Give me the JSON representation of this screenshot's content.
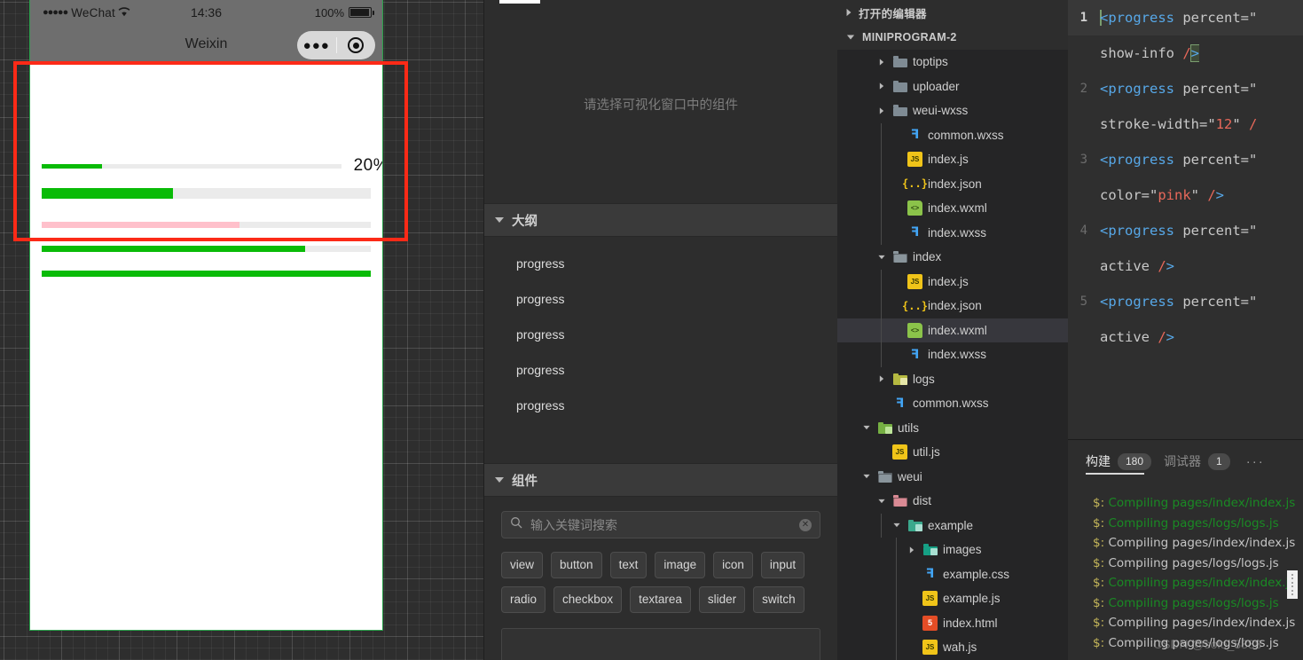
{
  "simulator": {
    "status_bar": {
      "carrier_dots": "●●●●●",
      "carrier": "WeChat",
      "wifi_icon": "wifi-icon",
      "time": "14:36",
      "battery_percent": "100%",
      "battery_icon": "battery-full-icon"
    },
    "nav_bar": {
      "title": "Weixin",
      "capsule_more_icon": "more-dots-icon",
      "capsule_target_icon": "target-circle-icon"
    },
    "progress_bars": [
      {
        "percent": 20,
        "color": "#09BB07",
        "track": "#EBEBEB",
        "height": 5,
        "width_pct": 91,
        "show_info": true,
        "info_label": "20%"
      },
      {
        "percent": 40,
        "color": "#09BB07",
        "track": "#EBEBEB",
        "height": 12,
        "width_pct": 100,
        "show_info": false,
        "info_label": ""
      },
      {
        "percent": 60,
        "color": "#FFC0CB",
        "track": "#EBEBEB",
        "height": 7,
        "width_pct": 100,
        "show_info": false,
        "info_label": ""
      },
      {
        "percent": 80,
        "color": "#09BB07",
        "track": "#EBEBEB",
        "height": 7,
        "width_pct": 100,
        "show_info": false,
        "info_label": ""
      },
      {
        "percent": 100,
        "color": "#09BB07",
        "track": "#EBEBEB",
        "height": 7,
        "width_pct": 100,
        "show_info": false,
        "info_label": ""
      }
    ],
    "highlight_color": "#FC2A17"
  },
  "middle_panel": {
    "wxml_placeholder": "请选择可视化窗口中的组件",
    "outline": {
      "title": "大纲",
      "items": [
        {
          "label": "progress"
        },
        {
          "label": "progress"
        },
        {
          "label": "progress"
        },
        {
          "label": "progress"
        },
        {
          "label": "progress"
        }
      ]
    },
    "components": {
      "title": "组件",
      "search_placeholder": "输入关键词搜索",
      "search_value": "",
      "search_icon": "search-icon",
      "clear_icon": "clear-circle-icon",
      "tags": [
        "view",
        "button",
        "text",
        "image",
        "icon",
        "input",
        "radio",
        "checkbox",
        "textarea",
        "slider",
        "switch"
      ]
    }
  },
  "file_tree": {
    "open_editors_label": "打开的编辑器",
    "project_label": "MINIPROGRAM-2",
    "nodes": [
      {
        "label": "toptips",
        "type": "folder",
        "depth": 2,
        "expanded": false,
        "selected": false
      },
      {
        "label": "uploader",
        "type": "folder",
        "depth": 2,
        "expanded": false,
        "selected": false
      },
      {
        "label": "weui-wxss",
        "type": "folder",
        "depth": 2,
        "expanded": false,
        "selected": false
      },
      {
        "label": "common.wxss",
        "type": "css",
        "depth": 3,
        "expanded": null,
        "selected": false
      },
      {
        "label": "index.js",
        "type": "js",
        "depth": 3,
        "expanded": null,
        "selected": false
      },
      {
        "label": "index.json",
        "type": "json",
        "depth": 3,
        "expanded": null,
        "selected": false
      },
      {
        "label": "index.wxml",
        "type": "wxml",
        "depth": 3,
        "expanded": null,
        "selected": false
      },
      {
        "label": "index.wxss",
        "type": "css",
        "depth": 3,
        "expanded": null,
        "selected": false
      },
      {
        "label": "index",
        "type": "folder-open",
        "depth": 2,
        "expanded": true,
        "selected": false
      },
      {
        "label": "index.js",
        "type": "js",
        "depth": 3,
        "expanded": null,
        "selected": false
      },
      {
        "label": "index.json",
        "type": "json",
        "depth": 3,
        "expanded": null,
        "selected": false
      },
      {
        "label": "index.wxml",
        "type": "wxml",
        "depth": 3,
        "expanded": null,
        "selected": true
      },
      {
        "label": "index.wxss",
        "type": "css",
        "depth": 3,
        "expanded": null,
        "selected": false
      },
      {
        "label": "logs",
        "type": "folder-logs",
        "depth": 2,
        "expanded": false,
        "selected": false
      },
      {
        "label": "common.wxss",
        "type": "css",
        "depth": 2,
        "expanded": null,
        "selected": false
      },
      {
        "label": "utils",
        "type": "folder-utils",
        "depth": 1,
        "expanded": true,
        "selected": false
      },
      {
        "label": "util.js",
        "type": "js",
        "depth": 2,
        "expanded": null,
        "selected": false
      },
      {
        "label": "weui",
        "type": "folder-open",
        "depth": 1,
        "expanded": true,
        "selected": false
      },
      {
        "label": "dist",
        "type": "folder-dist",
        "depth": 2,
        "expanded": true,
        "selected": false
      },
      {
        "label": "example",
        "type": "folder-img",
        "depth": 3,
        "expanded": true,
        "selected": false
      },
      {
        "label": "images",
        "type": "folder-img2",
        "depth": 4,
        "expanded": false,
        "selected": false
      },
      {
        "label": "example.css",
        "type": "css",
        "depth": 4,
        "expanded": null,
        "selected": false
      },
      {
        "label": "example.js",
        "type": "js",
        "depth": 4,
        "expanded": null,
        "selected": false
      },
      {
        "label": "index.html",
        "type": "html",
        "depth": 4,
        "expanded": null,
        "selected": false
      },
      {
        "label": "wah.js",
        "type": "js",
        "depth": 4,
        "expanded": null,
        "selected": false
      }
    ]
  },
  "editor": {
    "lines": [
      {
        "number": "1",
        "current": true,
        "segments": [
          {
            "text": "<progress",
            "cls": "tok-tag",
            "cursor_start": true
          },
          {
            "text": " percent=\"",
            "cls": "tok-attr"
          }
        ],
        "wrap": [
          {
            "text": "show-info ",
            "cls": "tok-attr"
          },
          {
            "text": "/",
            "cls": "tok-slash"
          },
          {
            "text": ">",
            "cls": "tok-tag",
            "cursor": true
          }
        ]
      },
      {
        "number": "2",
        "current": false,
        "segments": [
          {
            "text": "<progress",
            "cls": "tok-tag"
          },
          {
            "text": " percent=\"",
            "cls": "tok-attr"
          }
        ],
        "wrap": [
          {
            "text": "stroke-width=\"",
            "cls": "tok-attr"
          },
          {
            "text": "12",
            "cls": "tok-num"
          },
          {
            "text": "\" ",
            "cls": "tok-attr"
          },
          {
            "text": "/",
            "cls": "tok-slash"
          }
        ]
      },
      {
        "number": "3",
        "current": false,
        "segments": [
          {
            "text": "<progress",
            "cls": "tok-tag"
          },
          {
            "text": " percent=\"",
            "cls": "tok-attr"
          }
        ],
        "wrap": [
          {
            "text": "color=\"",
            "cls": "tok-attr"
          },
          {
            "text": "pink",
            "cls": "tok-pink"
          },
          {
            "text": "\" ",
            "cls": "tok-attr"
          },
          {
            "text": "/",
            "cls": "tok-slash"
          },
          {
            "text": ">",
            "cls": "tok-tag"
          }
        ]
      },
      {
        "number": "4",
        "current": false,
        "segments": [
          {
            "text": "<progress",
            "cls": "tok-tag"
          },
          {
            "text": " percent=\"",
            "cls": "tok-attr"
          }
        ],
        "wrap": [
          {
            "text": "active ",
            "cls": "tok-attr"
          },
          {
            "text": "/",
            "cls": "tok-slash"
          },
          {
            "text": ">",
            "cls": "tok-tag"
          }
        ]
      },
      {
        "number": "5",
        "current": false,
        "segments": [
          {
            "text": "<progress",
            "cls": "tok-tag"
          },
          {
            "text": " percent=\"",
            "cls": "tok-attr"
          }
        ],
        "wrap": [
          {
            "text": "active ",
            "cls": "tok-attr"
          },
          {
            "text": "/",
            "cls": "tok-slash"
          },
          {
            "text": ">",
            "cls": "tok-tag"
          }
        ]
      }
    ]
  },
  "console": {
    "tabs": [
      {
        "label": "构建",
        "badge": "180",
        "active": true
      },
      {
        "label": "调试器",
        "badge": "1",
        "active": false
      }
    ],
    "overflow_icon": "more-horizontal-icon",
    "log_lines": [
      {
        "prompt": "$:",
        "text": "Compiling pages/index/index.js",
        "color": "green"
      },
      {
        "prompt": "$:",
        "text": "Compiling pages/logs/logs.js",
        "color": "green"
      },
      {
        "prompt": "$:",
        "text": "Compiling pages/index/index.js",
        "color": "grey"
      },
      {
        "prompt": "$:",
        "text": "Compiling pages/logs/logs.js",
        "color": "grey"
      },
      {
        "prompt": "$:",
        "text": "Compiling pages/index/index.js",
        "color": "green"
      },
      {
        "prompt": "$:",
        "text": "Compiling pages/logs/logs.js",
        "color": "green"
      },
      {
        "prompt": "$:",
        "text": "Compiling pages/index/index.js",
        "color": "grey"
      },
      {
        "prompt": "$:",
        "text": "Compiling pages/logs/logs.js",
        "color": "grey"
      }
    ],
    "grip_icon": "drag-grip-icon"
  },
  "watermark": "CSDN @solo_8888"
}
